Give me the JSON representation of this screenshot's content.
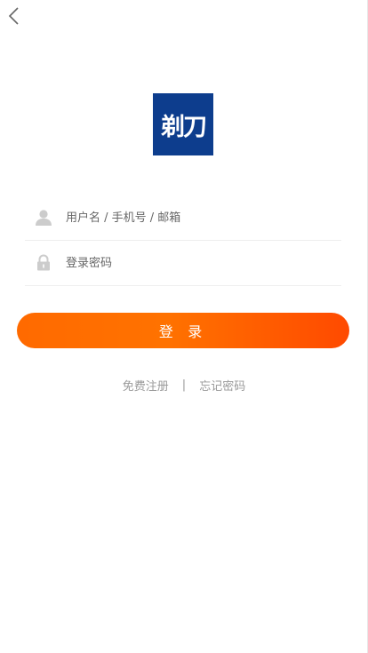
{
  "logo": {
    "text": "剃刀",
    "background_color": "#0d3d8d"
  },
  "form": {
    "username_placeholder": "用户名 / 手机号 / 邮箱",
    "password_placeholder": "登录密码",
    "username_value": "",
    "password_value": ""
  },
  "login_button": {
    "label": "登 录",
    "gradient": [
      "#ff6a00",
      "#ff4a00"
    ]
  },
  "links": {
    "register": "免费注册",
    "separator": "|",
    "forgot_password": "忘记密码"
  },
  "icons": {
    "back": "chevron-left-icon",
    "user": "user-icon",
    "lock": "lock-icon"
  }
}
